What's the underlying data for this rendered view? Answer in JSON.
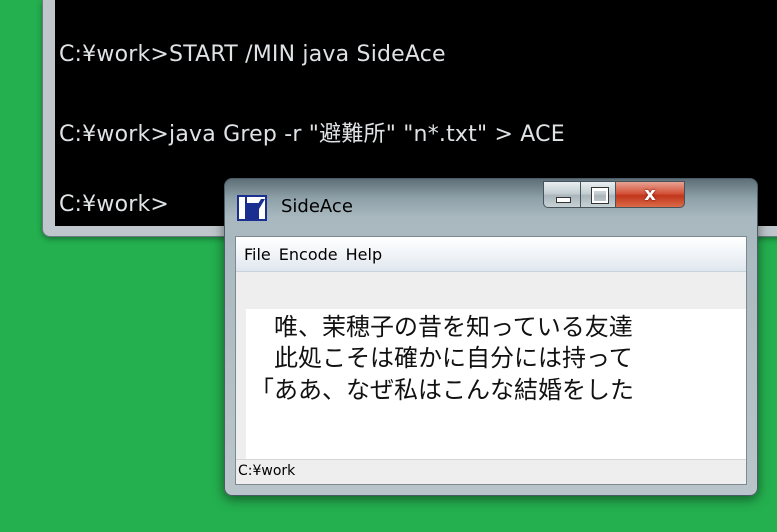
{
  "console": {
    "lines": [
      "C:¥work>START /MIN java SideAce",
      "C:¥work>java Grep -r \"避難所\" \"n*.txt\" > ACE",
      "C:¥work>"
    ]
  },
  "sideace": {
    "title": "SideAce",
    "menu": [
      "File",
      "Encode",
      "Help"
    ],
    "text_lines": [
      "　唯、茉穂子の昔を知っている友達",
      "　此処こそは確かに自分には持って",
      "「ああ、なぜ私はこんな結婚をした"
    ],
    "status": "C:¥work",
    "close_label": "x"
  },
  "colors": {
    "desktop": "#24b04f",
    "console_bg": "#000000",
    "console_text": "#dfe3e6",
    "close_red": "#c1361c"
  }
}
